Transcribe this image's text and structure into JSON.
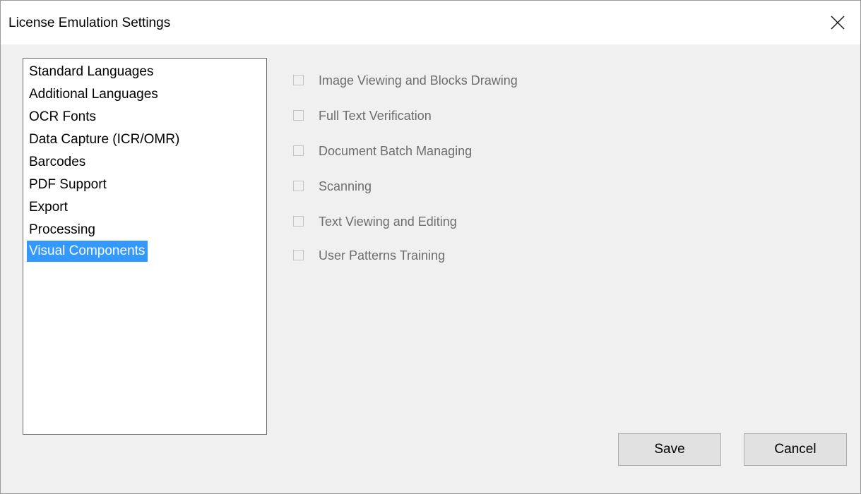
{
  "window": {
    "title": "License Emulation Settings"
  },
  "sidebar": {
    "items": [
      {
        "label": "Standard Languages",
        "selected": false
      },
      {
        "label": "Additional Languages",
        "selected": false
      },
      {
        "label": "OCR Fonts",
        "selected": false
      },
      {
        "label": "Data Capture (ICR/OMR)",
        "selected": false
      },
      {
        "label": "Barcodes",
        "selected": false
      },
      {
        "label": "PDF Support",
        "selected": false
      },
      {
        "label": "Export",
        "selected": false
      },
      {
        "label": "Processing",
        "selected": false
      },
      {
        "label": "Visual Components",
        "selected": true
      }
    ]
  },
  "options": [
    {
      "label": "Image Viewing and Blocks Drawing",
      "checked": false,
      "enabled": false
    },
    {
      "label": "Full Text Verification",
      "checked": false,
      "enabled": false
    },
    {
      "label": "Document Batch Managing",
      "checked": false,
      "enabled": false
    },
    {
      "label": "Scanning",
      "checked": false,
      "enabled": false
    },
    {
      "label": "Text Viewing and Editing",
      "checked": false,
      "enabled": false
    },
    {
      "label": "User Patterns Training",
      "checked": false,
      "enabled": false
    }
  ],
  "buttons": {
    "save_label": "Save",
    "cancel_label": "Cancel"
  },
  "colors": {
    "selection": "#3399ff",
    "disabled_text": "#6d6d6d",
    "dialog_background": "#f0f0f0"
  },
  "icons": {
    "close": "close-icon"
  }
}
